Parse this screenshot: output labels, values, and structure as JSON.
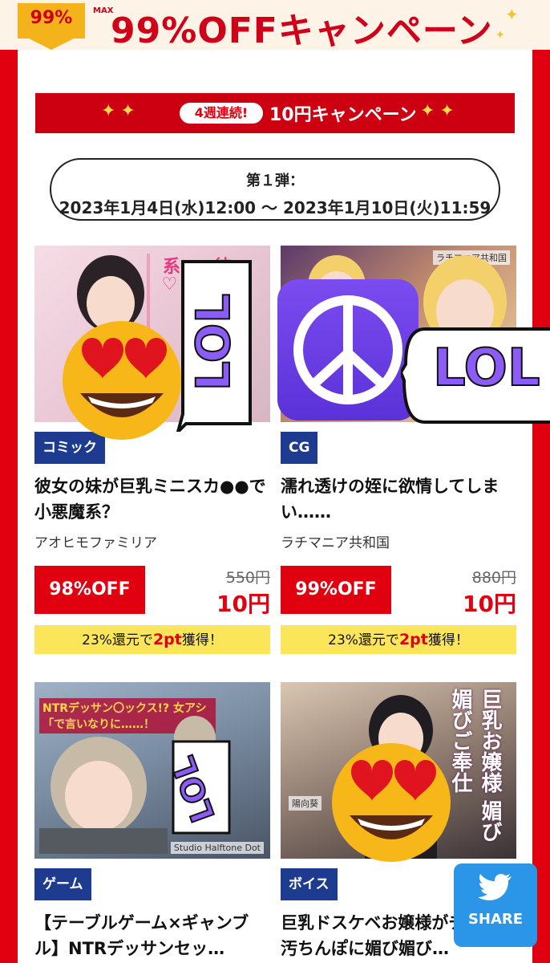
{
  "banner": {
    "badge": "99%",
    "max_label": "MAX",
    "headline": "99%OFFキャンペーン"
  },
  "ribbon": {
    "pill": "4週連続!",
    "title": "10円キャンペーン"
  },
  "period": {
    "line1": "第１弾：",
    "line2": "2023年1月4日(水)12:00 〜 2023年1月10日(火)11:59"
  },
  "products": [
    {
      "category": "コミック",
      "title": "彼女の妹が巨乳ミニスカ●●で小悪魔系？",
      "maker": "アオヒモファミリア",
      "off": "98%OFF",
      "old_price": "550円",
      "price": "10円",
      "point_prefix": "23%還元で",
      "point_value": "2pt",
      "point_suffix": "獲得！",
      "thumb_text": "彼女の妹が巨乳ミニスカJKで小悪魔系♡"
    },
    {
      "category": "CG",
      "title": "濡れ透けの姪に欲情してしまい……",
      "maker": "ラチマニア共和国",
      "off": "99%OFF",
      "old_price": "880円",
      "price": "10円",
      "point_prefix": "23%還元で",
      "point_value": "2pt",
      "point_suffix": "獲得！",
      "thumb_text": "ラチマニア共和国"
    },
    {
      "category": "ゲーム",
      "title": "【テーブルゲーム×ギャンブル】NTRデッサンセッ…",
      "thumb_text": "NTRデッサン〇ックス!? 女アシ「で言いなりに……！",
      "thumb_studio": "Studio Halftone Dot"
    },
    {
      "category": "ボイス",
      "title": "巨乳ドスケベお嬢様がチンカス汚ちんぽに媚び媚び…",
      "thumb_text": "巨乳お嬢様 媚び媚びご奉仕",
      "thumb_studio": "陽向葵"
    }
  ],
  "stickers": {
    "lol": "LOL"
  },
  "share": {
    "label": "SHARE"
  },
  "colors": {
    "brand_red": "#e0000f",
    "category_blue": "#1d3c8f",
    "point_yellow": "#fbe55b",
    "share_blue": "#2b95e8"
  }
}
